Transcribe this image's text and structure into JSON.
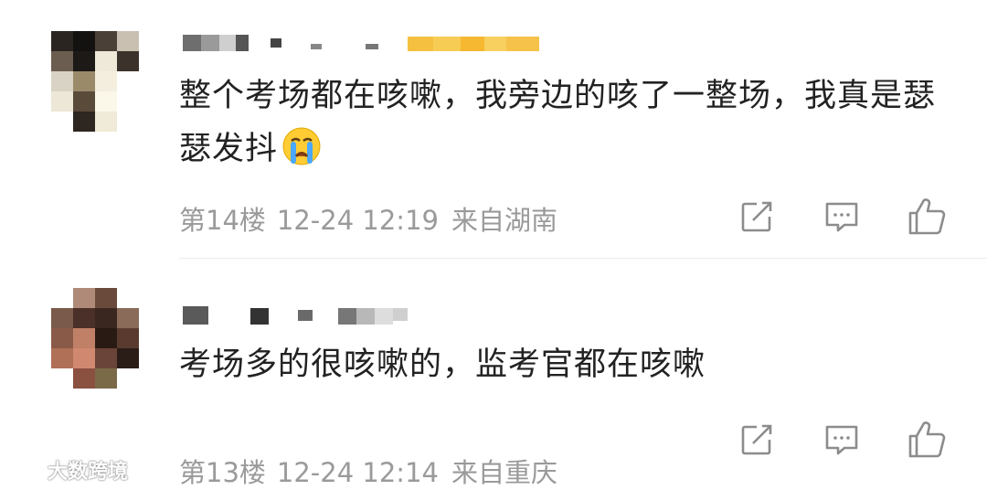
{
  "comments": [
    {
      "username": "",
      "text": "整个考场都在咳嗽，我旁边的咳了一整场，我真是瑟瑟发抖",
      "emoji": "crying-face",
      "floor": "第14楼",
      "datetime": "12-24 12:19",
      "location": "来自湖南"
    },
    {
      "username": "",
      "text": "考场多的很咳嗽的，监考官都在咳嗽",
      "floor": "第13楼",
      "datetime": "12-24 12:14",
      "location": "来自重庆"
    }
  ],
  "actions": {
    "share_icon": "share-icon",
    "reply_icon": "reply-icon",
    "like_icon": "like-icon"
  },
  "watermark": {
    "text": "大数跨境"
  },
  "colors": {
    "text": "#222222",
    "meta": "#9a9a9a",
    "icon": "#8c8c8c",
    "divider": "#ececec"
  }
}
